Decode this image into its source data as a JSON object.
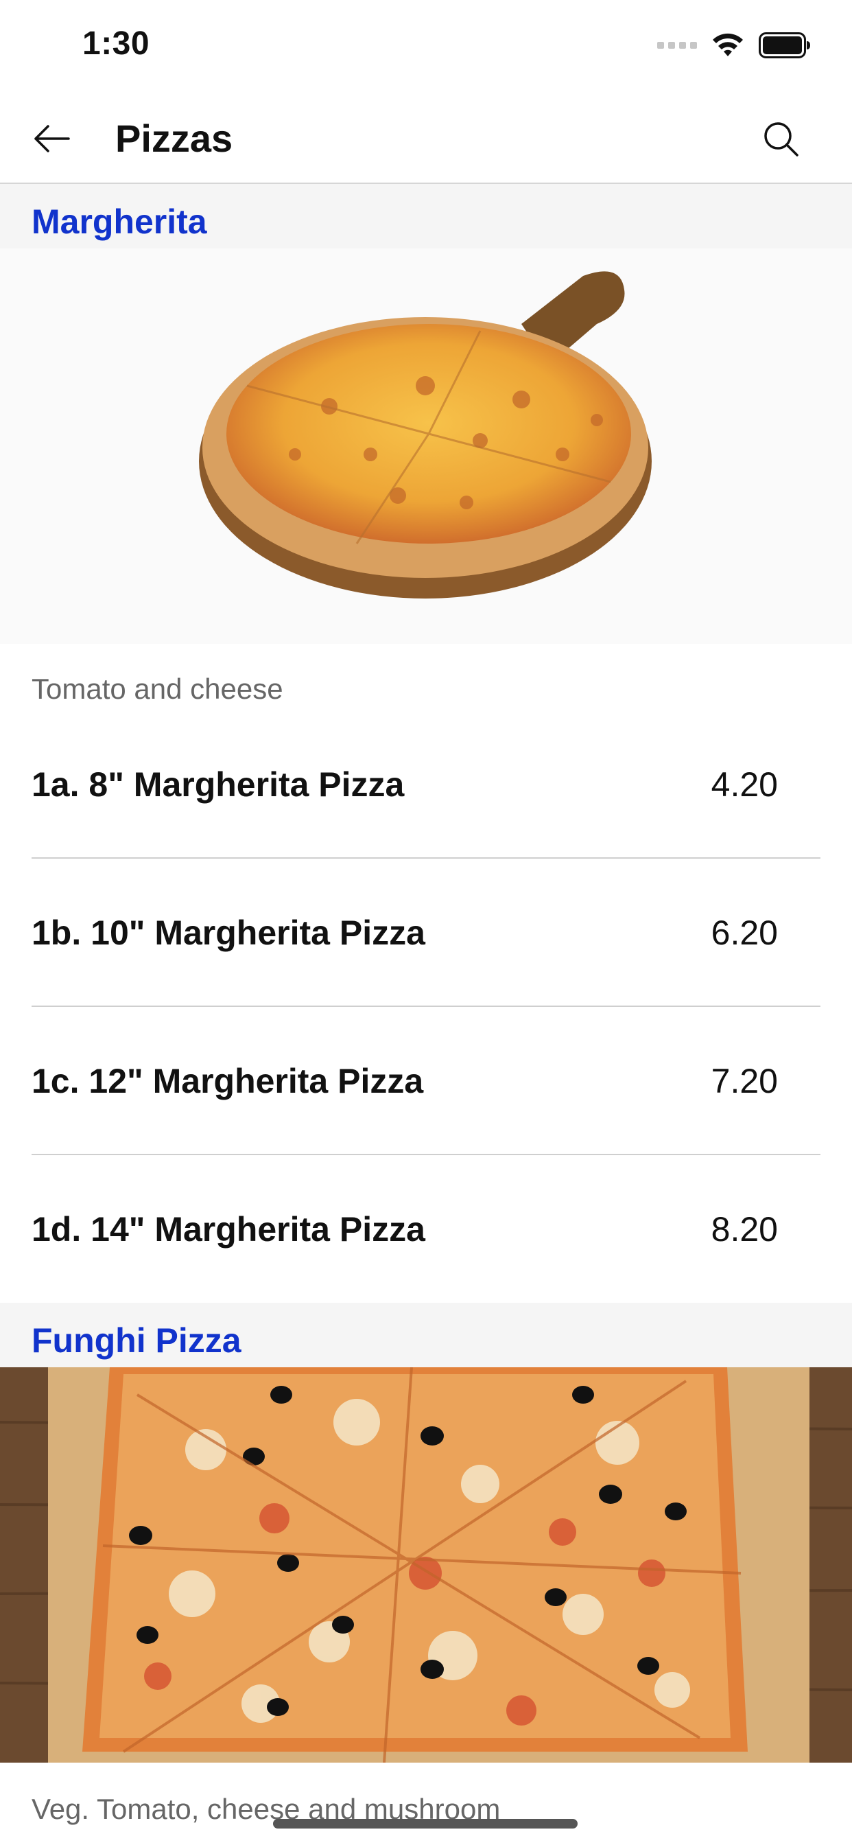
{
  "status": {
    "time": "1:30"
  },
  "nav": {
    "title": "Pizzas"
  },
  "sections": [
    {
      "title": "Margherita",
      "description": "Tomato and cheese",
      "items": [
        {
          "name": "1a. 8\" Margherita Pizza",
          "price": "4.20"
        },
        {
          "name": "1b. 10\" Margherita Pizza",
          "price": "6.20"
        },
        {
          "name": "1c. 12\" Margherita Pizza",
          "price": "7.20"
        },
        {
          "name": "1d. 14\" Margherita Pizza",
          "price": "8.20"
        }
      ]
    },
    {
      "title": "Funghi Pizza",
      "description": "Veg. Tomato, cheese and mushroom"
    }
  ],
  "icons": {
    "back": "arrow-left-icon",
    "search": "search-icon",
    "signal": "signal-icon",
    "wifi": "wifi-icon",
    "battery": "battery-icon"
  },
  "colors": {
    "section_title": "#1133cc",
    "section_bg": "#f5f5f5",
    "divider": "#cfcfcf"
  }
}
